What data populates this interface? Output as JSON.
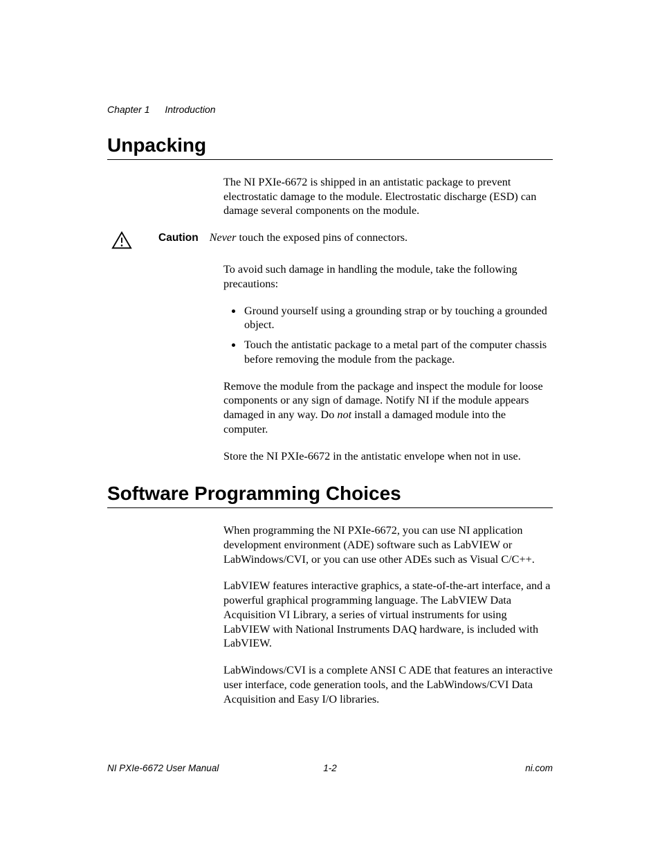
{
  "header": {
    "chapter": "Chapter 1",
    "title": "Introduction"
  },
  "section1": {
    "heading": "Unpacking",
    "p1": "The NI PXIe-6672 is shipped in an antistatic package to prevent electrostatic damage to the module. Electrostatic discharge (ESD) can damage several components on the module.",
    "caution_label": "Caution",
    "caution_italic": "Never",
    "caution_rest": " touch the exposed pins of connectors.",
    "p2": "To avoid such damage in handling the module, take the following precautions:",
    "bullets": [
      "Ground yourself using a grounding strap or by touching a grounded object.",
      "Touch the antistatic package to a metal part of the computer chassis before removing the module from the package."
    ],
    "p3_a": "Remove the module from the package and inspect the module for loose components or any sign of damage. Notify NI if the module appears damaged in any way. Do ",
    "p3_italic": "not",
    "p3_b": " install a damaged module into the computer.",
    "p4": "Store the NI PXIe-6672 in the antistatic envelope when not in use."
  },
  "section2": {
    "heading": "Software Programming Choices",
    "p1": "When programming the NI PXIe-6672, you can use NI application development environment (ADE) software such as LabVIEW or LabWindows/CVI, or you can use other ADEs such as Visual C/C++.",
    "p2": "LabVIEW features interactive graphics, a state-of-the-art interface, and a powerful graphical programming language. The LabVIEW Data Acquisition VI Library, a series of virtual instruments for using LabVIEW with National Instruments DAQ hardware, is included with LabVIEW.",
    "p3": "LabWindows/CVI is a complete ANSI C ADE that features an interactive user interface, code generation tools, and the LabWindows/CVI Data Acquisition and Easy I/O libraries."
  },
  "footer": {
    "left": "NI PXIe-6672 User Manual",
    "center": "1-2",
    "right": "ni.com"
  }
}
